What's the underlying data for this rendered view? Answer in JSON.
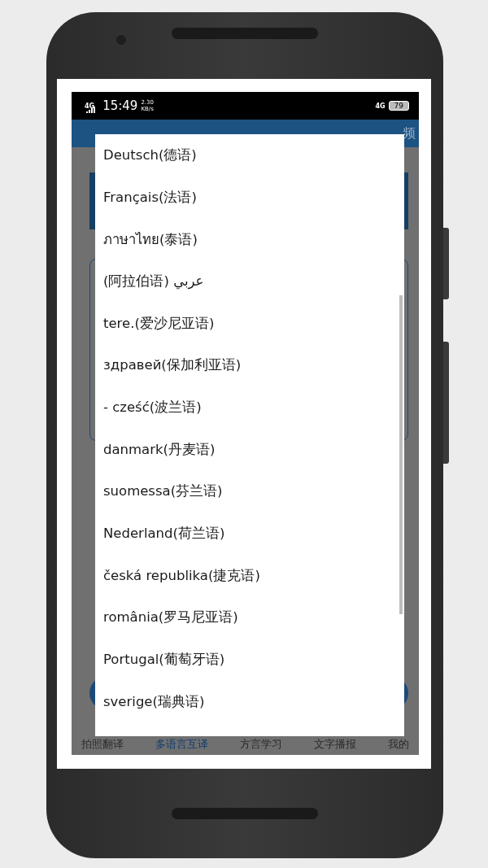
{
  "status_bar": {
    "network": "4G",
    "time": "15:49",
    "speed": "2.30",
    "speed_unit": "KB/s",
    "right_network": "4G",
    "battery": "79"
  },
  "header": {
    "action": "频"
  },
  "language_dialog": {
    "items": [
      {
        "label": "Deutsch(德语)"
      },
      {
        "label": "Français(法语)"
      },
      {
        "label": "ภาษาไทย(泰语)"
      },
      {
        "label": "(阿拉伯语) عربي"
      },
      {
        "label": "tere.(爱沙尼亚语)"
      },
      {
        "label": "здравей(保加利亚语)"
      },
      {
        "label": "- cześć(波兰语)"
      },
      {
        "label": "danmark(丹麦语)"
      },
      {
        "label": "suomessa(芬兰语)"
      },
      {
        "label": "Nederland(荷兰语)"
      },
      {
        "label": "česká republika(捷克语)"
      },
      {
        "label": "românia(罗马尼亚语)"
      },
      {
        "label": "Portugal(葡萄牙语)"
      },
      {
        "label": "sverige(瑞典语)"
      }
    ]
  },
  "bottom_nav": [
    {
      "label": "拍照翻译",
      "selected": false
    },
    {
      "label": "多语言互译",
      "selected": true
    },
    {
      "label": "方言学习",
      "selected": false
    },
    {
      "label": "文字播报",
      "selected": false
    },
    {
      "label": "我的",
      "selected": false
    }
  ]
}
